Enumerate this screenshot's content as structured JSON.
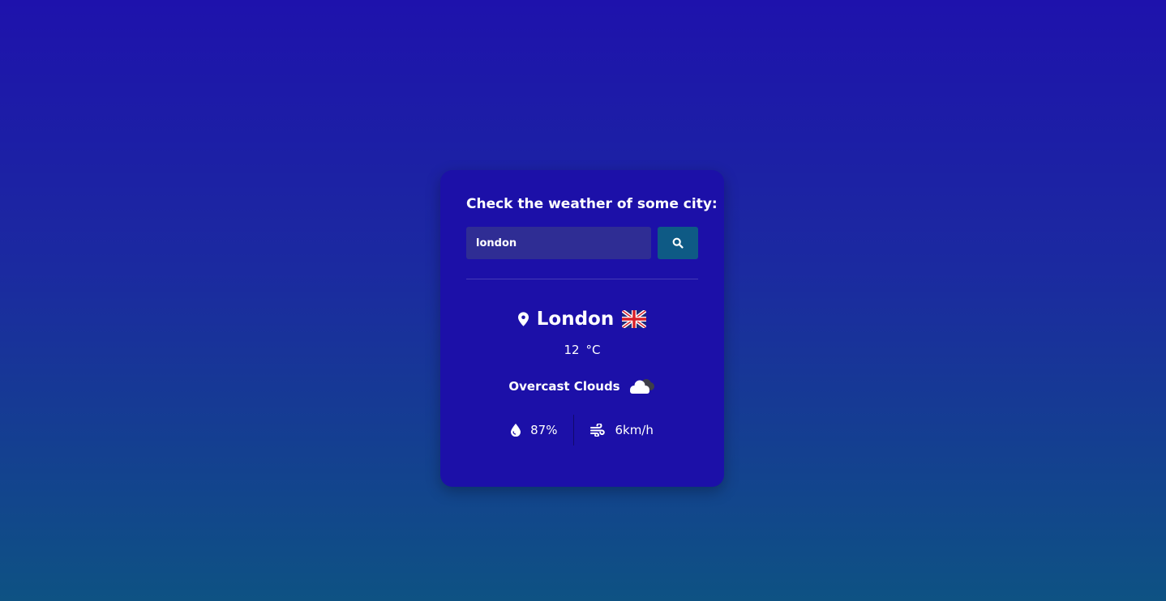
{
  "heading": "Check the weather of some city:",
  "search": {
    "value": "london",
    "placeholder": "",
    "button_icon": "search-icon"
  },
  "weather": {
    "city": "London",
    "city_icon": "map-pin-icon",
    "flag_icon": "uk-flag-icon",
    "temperature": "12",
    "unit": "°C",
    "description": "Overcast Clouds",
    "description_icon": "overcast-clouds-icon",
    "humidity": "87%",
    "humidity_icon": "water-drop-icon",
    "wind": "6km/h",
    "wind_icon": "wind-icon"
  },
  "colors": {
    "background_top": "#1e12ac",
    "background_bottom": "#0e5283",
    "card": "#1c10a8",
    "input": "#2f2d94",
    "button": "#0e5a85",
    "text": "#ffffff"
  }
}
